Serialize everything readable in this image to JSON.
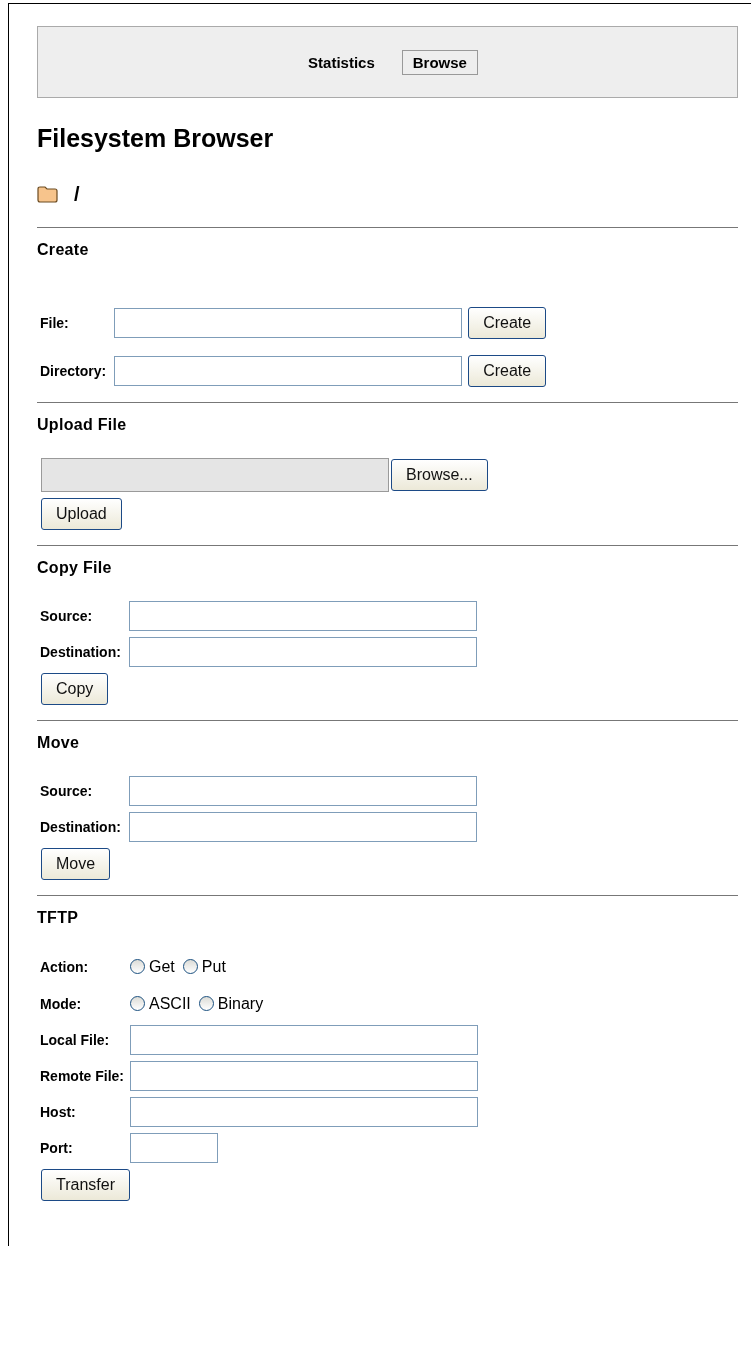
{
  "nav": [
    {
      "label": "Statistics",
      "selected": false
    },
    {
      "label": "Browse",
      "selected": true
    }
  ],
  "title": "Filesystem Browser",
  "path": "/",
  "sections": [
    {
      "heading": "Create",
      "rows": [
        {
          "kind": "text",
          "label": "File:",
          "button": "Create"
        },
        {
          "kind": "text",
          "label": "Directory:",
          "button": "Create"
        }
      ]
    },
    {
      "heading": "Upload File",
      "rows": [
        {
          "kind": "file",
          "button": "Browse..."
        }
      ],
      "buttons": [
        "Upload"
      ]
    },
    {
      "heading": "Copy File",
      "rows": [
        {
          "kind": "text",
          "label": "Source:"
        },
        {
          "kind": "text",
          "label": "Destination:"
        }
      ],
      "buttons": [
        "Copy"
      ]
    },
    {
      "heading": "Move",
      "rows": [
        {
          "kind": "text",
          "label": "Source:"
        },
        {
          "kind": "text",
          "label": "Destination:"
        }
      ],
      "buttons": [
        "Move"
      ]
    },
    {
      "heading": "TFTP",
      "rows": [
        {
          "kind": "radio",
          "label": "Action:",
          "options": [
            {
              "label": "Get",
              "selected": false
            },
            {
              "label": "Put",
              "selected": false
            }
          ]
        },
        {
          "kind": "radio",
          "label": "Mode:",
          "options": [
            {
              "label": "ASCII",
              "selected": false
            },
            {
              "label": "Binary",
              "selected": false
            }
          ]
        },
        {
          "kind": "text",
          "label": "Local File:"
        },
        {
          "kind": "text",
          "label": "Remote File:"
        },
        {
          "kind": "text",
          "label": "Host:"
        },
        {
          "kind": "short",
          "label": "Port:"
        }
      ],
      "buttons": [
        "Transfer"
      ]
    }
  ]
}
